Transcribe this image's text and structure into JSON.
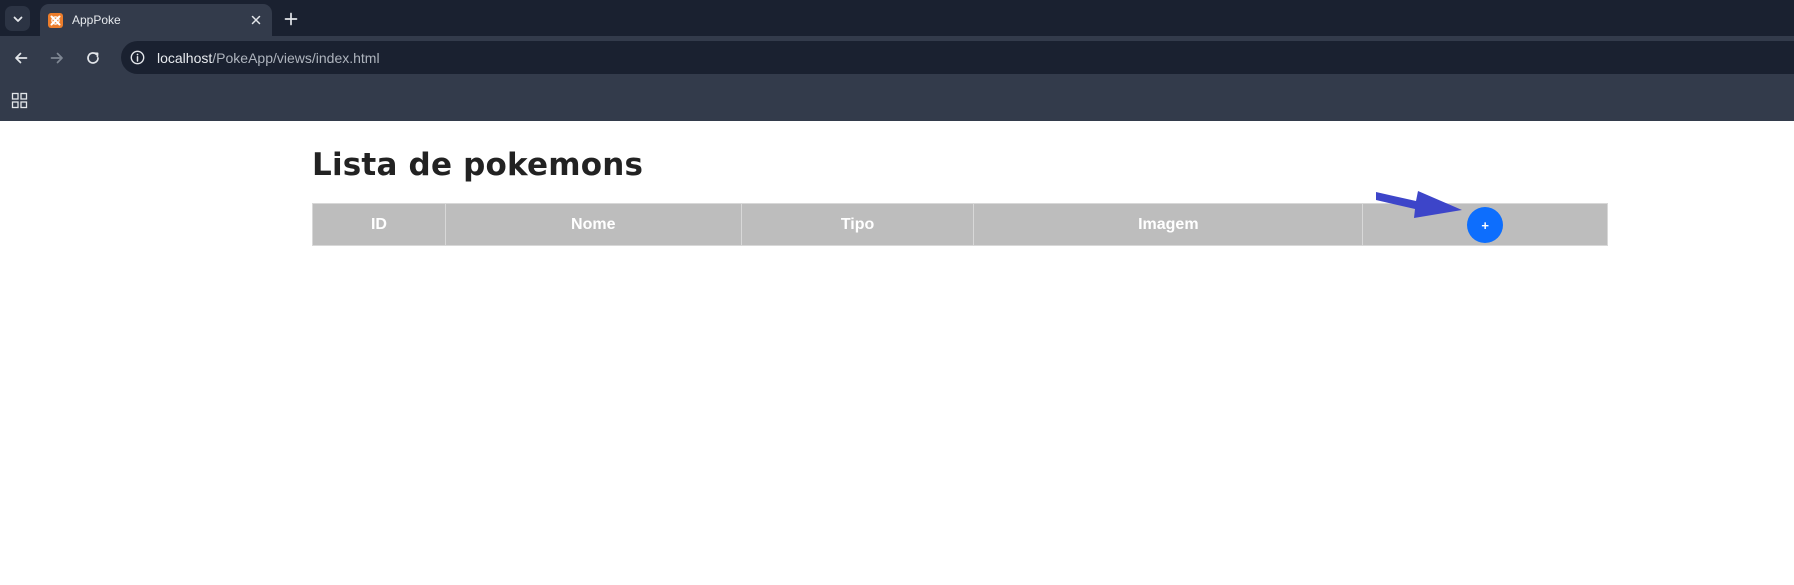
{
  "browser": {
    "tab": {
      "title": "AppPoke",
      "favicon_icon": "xampp-icon"
    },
    "address": {
      "host": "localhost",
      "path": "/PokeApp/views/index.html"
    },
    "colors": {
      "tabstrip": "#1a2130",
      "toolbar": "#333b4b",
      "omnibox": "#1a2130"
    }
  },
  "page": {
    "title": "Lista de pokemons",
    "table": {
      "headers": [
        "ID",
        "Nome",
        "Tipo",
        "Imagem"
      ],
      "add_button_label": "+"
    },
    "colors": {
      "header_bg": "#bdbdbd",
      "add_button": "#0d6efd",
      "annotation_arrow": "#3d45c9"
    }
  }
}
